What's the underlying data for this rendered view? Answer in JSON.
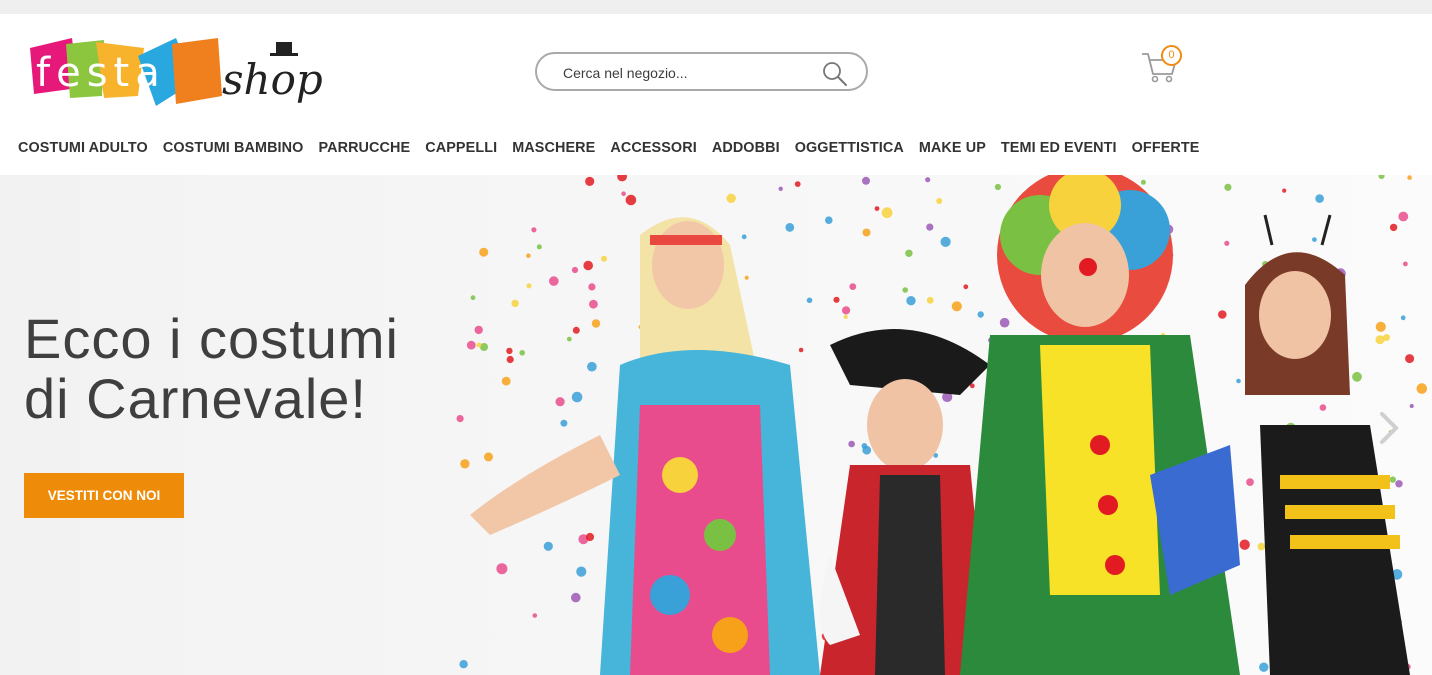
{
  "header": {
    "logo": {
      "word1": "festa",
      "word2": "shop",
      "alt": "Festa Shop"
    },
    "search": {
      "placeholder": "Cerca nel negozio...",
      "value": "",
      "icon": "search-icon"
    },
    "cart": {
      "count": "0",
      "icon": "cart-icon"
    }
  },
  "nav": {
    "items": [
      {
        "label": "COSTUMI ADULTO"
      },
      {
        "label": "COSTUMI BAMBINO"
      },
      {
        "label": "PARRUCCHE"
      },
      {
        "label": "CAPPELLI"
      },
      {
        "label": "MASCHERE"
      },
      {
        "label": "ACCESSORI"
      },
      {
        "label": "ADDOBBI"
      },
      {
        "label": "OGGETTISTICA"
      },
      {
        "label": "MAKE UP"
      },
      {
        "label": "TEMI ED EVENTI"
      },
      {
        "label": "OFFERTE"
      }
    ]
  },
  "hero": {
    "title_line1": "Ecco i costumi",
    "title_line2": "di Carnevale!",
    "cta": "VESTITI CON NOI",
    "next_icon": "chevron-right-icon"
  },
  "colors": {
    "accent": "#ee8c0a",
    "nav_text": "#333333",
    "title_text": "#3f3f3f",
    "topbar": "#efefef"
  }
}
